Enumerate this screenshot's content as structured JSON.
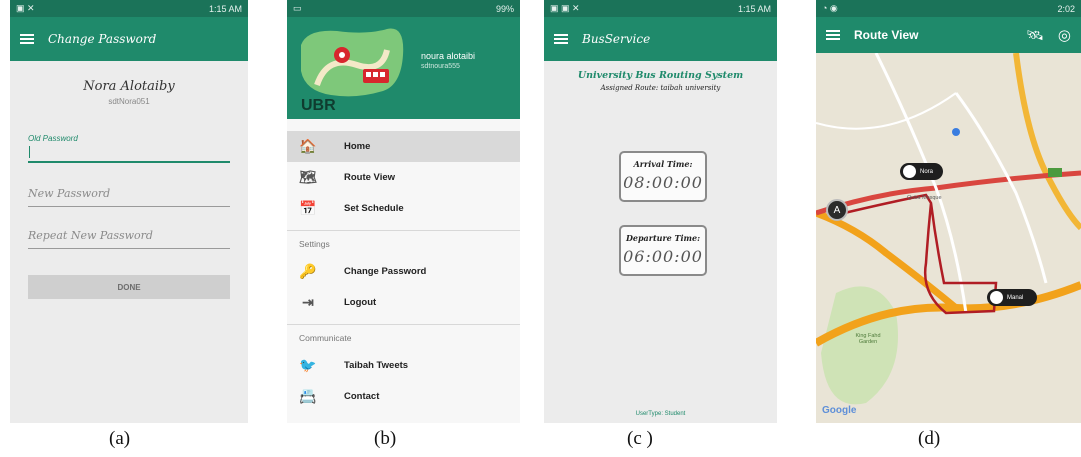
{
  "captions": [
    "(a)",
    "(b)",
    "(c )",
    "(d)"
  ],
  "screen_a": {
    "status_time": "1:15 AM",
    "title": "Change Password",
    "user_name": "Nora Alotaiby",
    "user_id": "sdtNora051",
    "old_password_label": "Old Password",
    "new_password_placeholder": "New Password",
    "repeat_password_placeholder": "Repeat New Password",
    "done_label": "DONE"
  },
  "screen_b": {
    "status_battery": "99%",
    "logo_text": "UBR",
    "user_name": "noura alotaibi",
    "user_id": "sdtnoura555",
    "menu": [
      {
        "label": "Home",
        "icon": "home-icon",
        "glyph": "🏠",
        "active": true
      },
      {
        "label": "Route View",
        "icon": "map-icon",
        "glyph": "🗺",
        "active": false
      },
      {
        "label": "Set Schedule",
        "icon": "calendar-icon",
        "glyph": "📅",
        "active": false
      }
    ],
    "settings_header": "Settings",
    "settings": [
      {
        "label": "Change Password",
        "icon": "key-icon",
        "glyph": "🔑"
      },
      {
        "label": "Logout",
        "icon": "logout-icon",
        "glyph": "⇥"
      }
    ],
    "communicate_header": "Communicate",
    "communicate": [
      {
        "label": "Taibah Tweets",
        "icon": "twitter-icon",
        "glyph": "🐦"
      },
      {
        "label": "Contact",
        "icon": "contact-card-icon",
        "glyph": "📇"
      }
    ]
  },
  "screen_c": {
    "status_time": "1:15 AM",
    "title": "BusService",
    "system_title": "University Bus Routing System",
    "assigned_route": "Assigned Route: taibah university",
    "arrival_label": "Arrival Time:",
    "arrival_value": "08:00:00",
    "departure_label": "Departure Time:",
    "departure_value": "06:00:00",
    "footer": "UserType: Student"
  },
  "screen_d": {
    "status_time": "2:02",
    "title": "Route View",
    "markers": [
      "Nora",
      "Manal"
    ],
    "start_marker": "A",
    "map_labels": [
      "Quba Mosque",
      "King Fahd Garden"
    ],
    "google": "Google"
  },
  "colors": {
    "primary": "#1f8a6b",
    "primary_dark": "#1b7359",
    "route_red": "#c0282d",
    "road_orange": "#f2a21b"
  }
}
